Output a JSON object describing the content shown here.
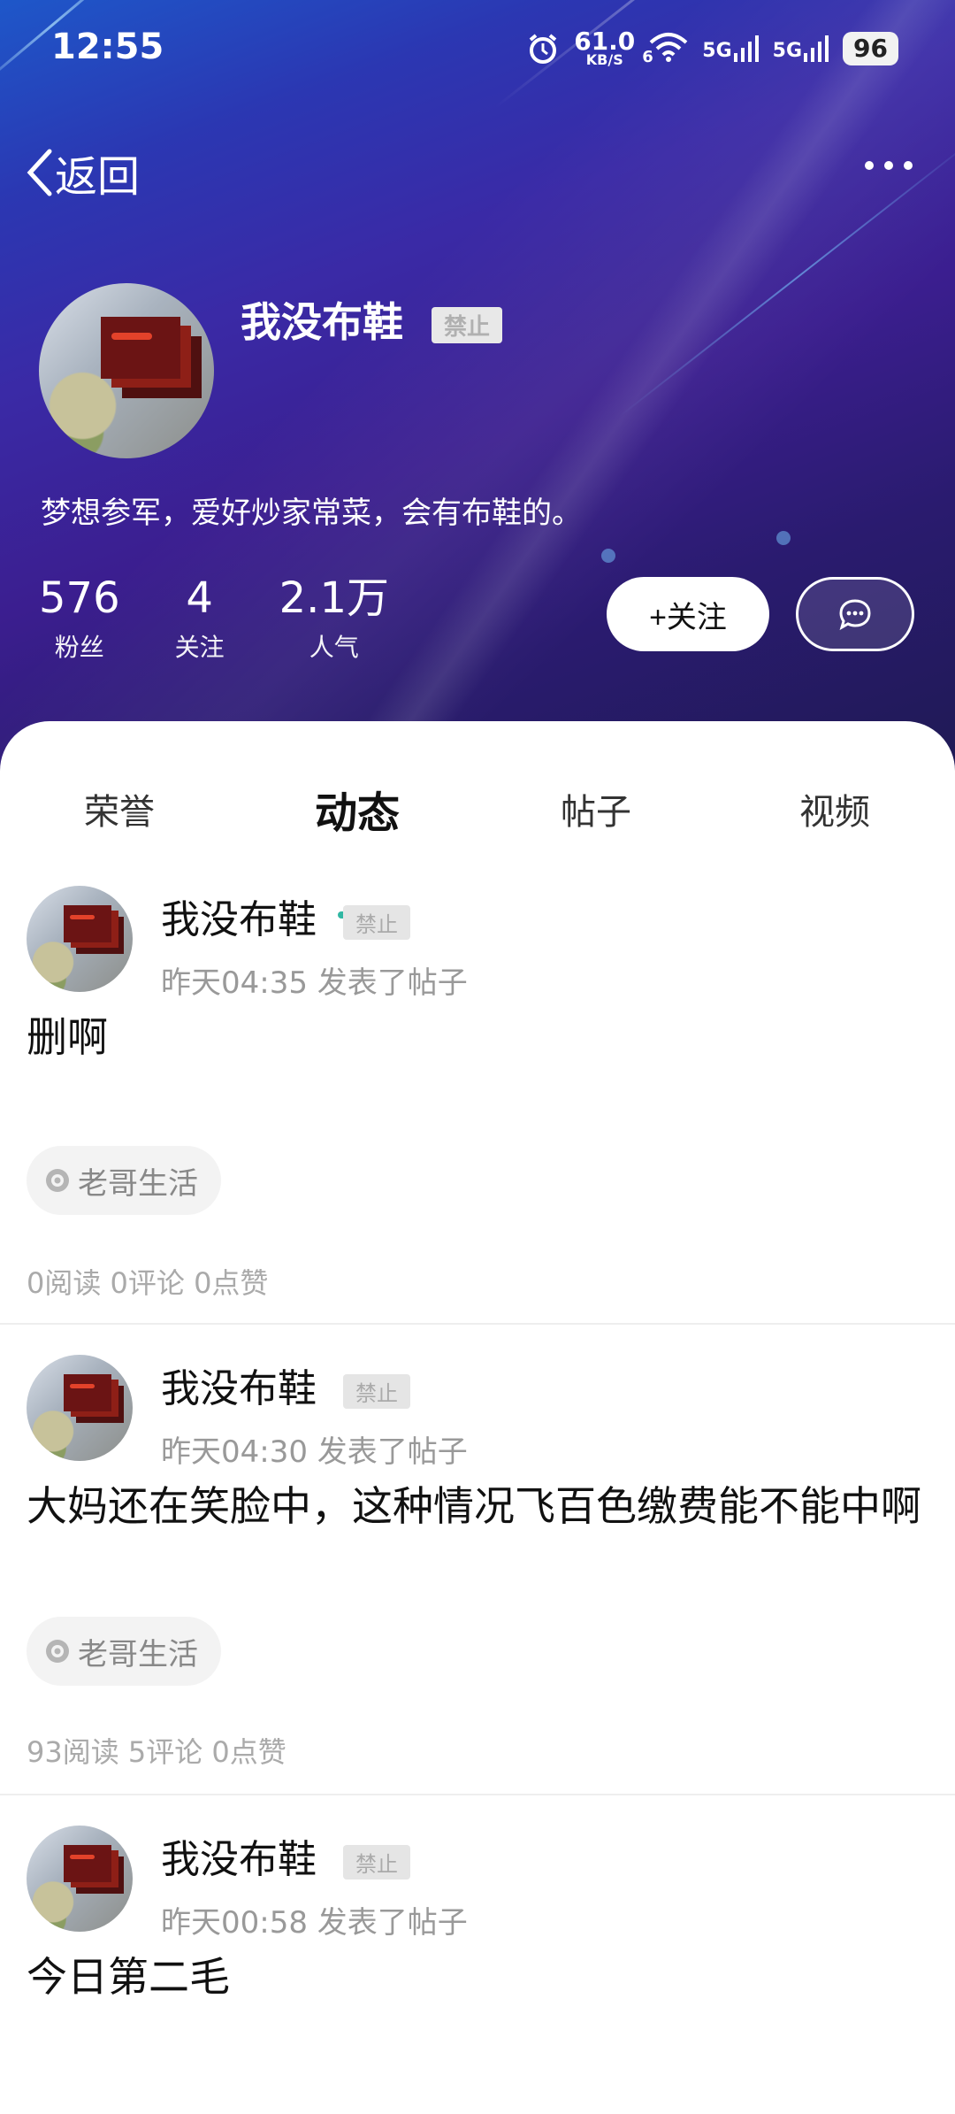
{
  "status_bar": {
    "time": "12:55",
    "speed_value": "61.0",
    "speed_unit": "KB/S",
    "wifi_sub": "6",
    "network1": "5G",
    "network2": "5G",
    "battery": "96"
  },
  "header": {
    "back_label": "返回"
  },
  "profile": {
    "username": "我没布鞋",
    "ban_label": "禁止",
    "bio": "梦想参军，爱好炒家常菜，会有布鞋的。",
    "stats": [
      {
        "value": "576",
        "label": "粉丝"
      },
      {
        "value": "4",
        "label": "关注"
      },
      {
        "value": "2.1万",
        "label": "人气"
      }
    ],
    "follow_label": "+关注"
  },
  "tabs": [
    {
      "label": "荣誉",
      "active": false
    },
    {
      "label": "动态",
      "active": true
    },
    {
      "label": "帖子",
      "active": false
    },
    {
      "label": "视频",
      "active": false
    }
  ],
  "posts": [
    {
      "author": "我没布鞋",
      "ban_label": "禁止",
      "time": "昨天04:35",
      "action": "发表了帖子",
      "content": "删啊",
      "topic": "老哥生活",
      "stats": "0阅读 0评论 0点赞"
    },
    {
      "author": "我没布鞋",
      "ban_label": "禁止",
      "time": "昨天04:30",
      "action": "发表了帖子",
      "content": "大妈还在笑脸中，这种情况飞百色缴费能不能中啊",
      "topic": "老哥生活",
      "stats": "93阅读 5评论 0点赞"
    },
    {
      "author": "我没布鞋",
      "ban_label": "禁止",
      "time": "昨天00:58",
      "action": "发表了帖子",
      "content": "今日第二毛"
    }
  ]
}
